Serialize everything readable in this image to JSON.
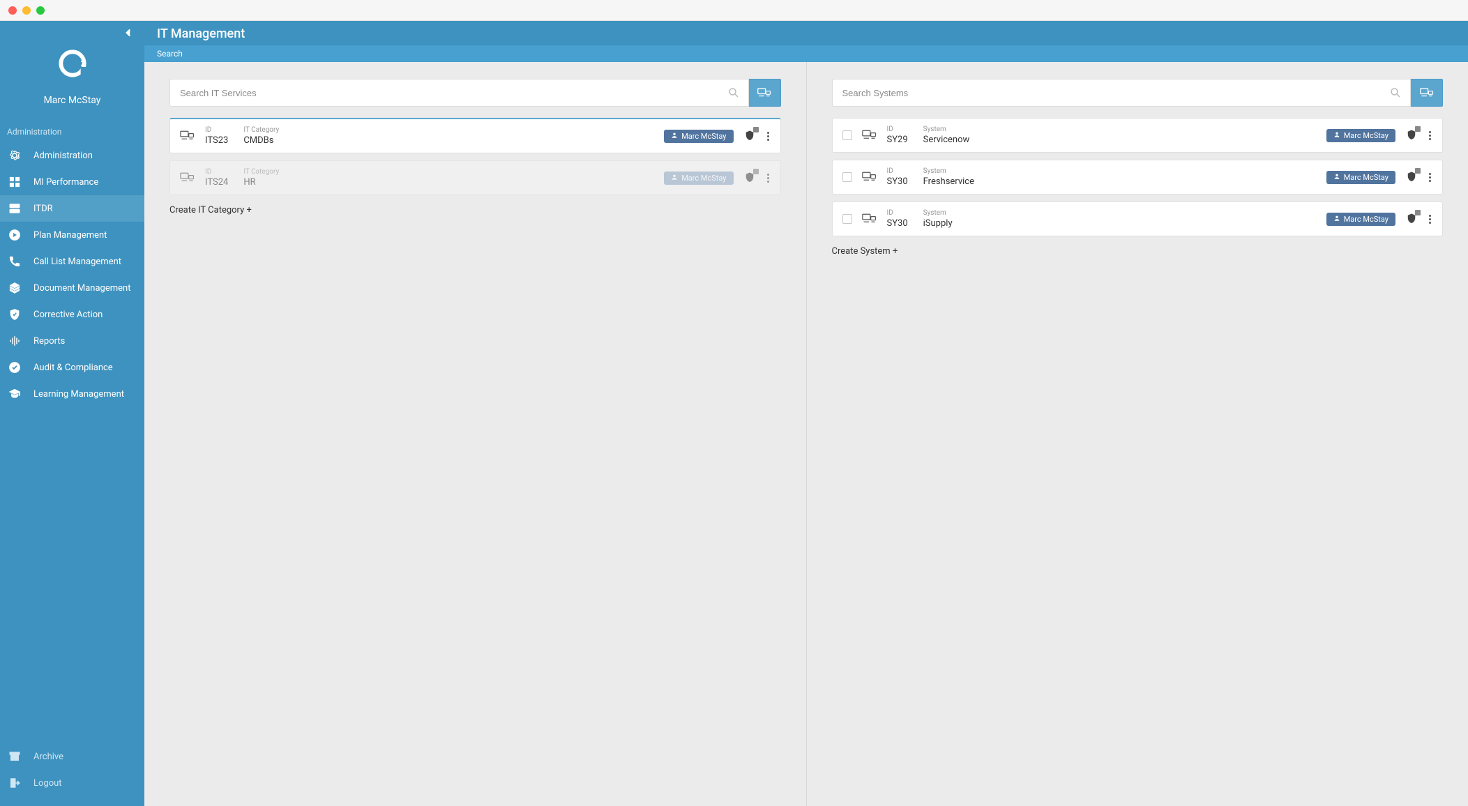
{
  "user": {
    "name": "Marc McStay"
  },
  "sidebar": {
    "section_label": "Administration",
    "items": [
      {
        "icon": "settings",
        "label": "Administration",
        "active": false
      },
      {
        "icon": "grid",
        "label": "MI Performance",
        "active": false
      },
      {
        "icon": "itdr",
        "label": "ITDR",
        "active": true
      },
      {
        "icon": "plan",
        "label": "Plan Management",
        "active": false
      },
      {
        "icon": "phone",
        "label": "Call List Management",
        "active": false
      },
      {
        "icon": "docs",
        "label": "Document Management",
        "active": false
      },
      {
        "icon": "shield",
        "label": "Corrective Action",
        "active": false
      },
      {
        "icon": "reports",
        "label": "Reports",
        "active": false
      },
      {
        "icon": "audit",
        "label": "Audit & Compliance",
        "active": false
      },
      {
        "icon": "learning",
        "label": "Learning Management",
        "active": false
      }
    ],
    "bottom": [
      {
        "icon": "archive",
        "label": "Archive"
      },
      {
        "icon": "logout",
        "label": "Logout"
      }
    ]
  },
  "header": {
    "title": "IT Management",
    "tab": "Search"
  },
  "left_pane": {
    "search_placeholder": "Search IT Services",
    "id_label": "ID",
    "category_label": "IT Category",
    "cards": [
      {
        "id": "ITS23",
        "name": "CMDBs",
        "owner": "Marc McStay",
        "selected": true,
        "disabled": false
      },
      {
        "id": "ITS24",
        "name": "HR",
        "owner": "Marc McStay",
        "selected": false,
        "disabled": true
      }
    ],
    "create_link": "Create IT Category +"
  },
  "right_pane": {
    "search_placeholder": "Search Systems",
    "id_label": "ID",
    "system_label": "System",
    "cards": [
      {
        "id": "SY29",
        "name": "Servicenow",
        "owner": "Marc McStay"
      },
      {
        "id": "SY30",
        "name": "Freshservice",
        "owner": "Marc McStay"
      },
      {
        "id": "SY30",
        "name": "iSupply",
        "owner": "Marc McStay"
      }
    ],
    "create_link": "Create System +"
  }
}
